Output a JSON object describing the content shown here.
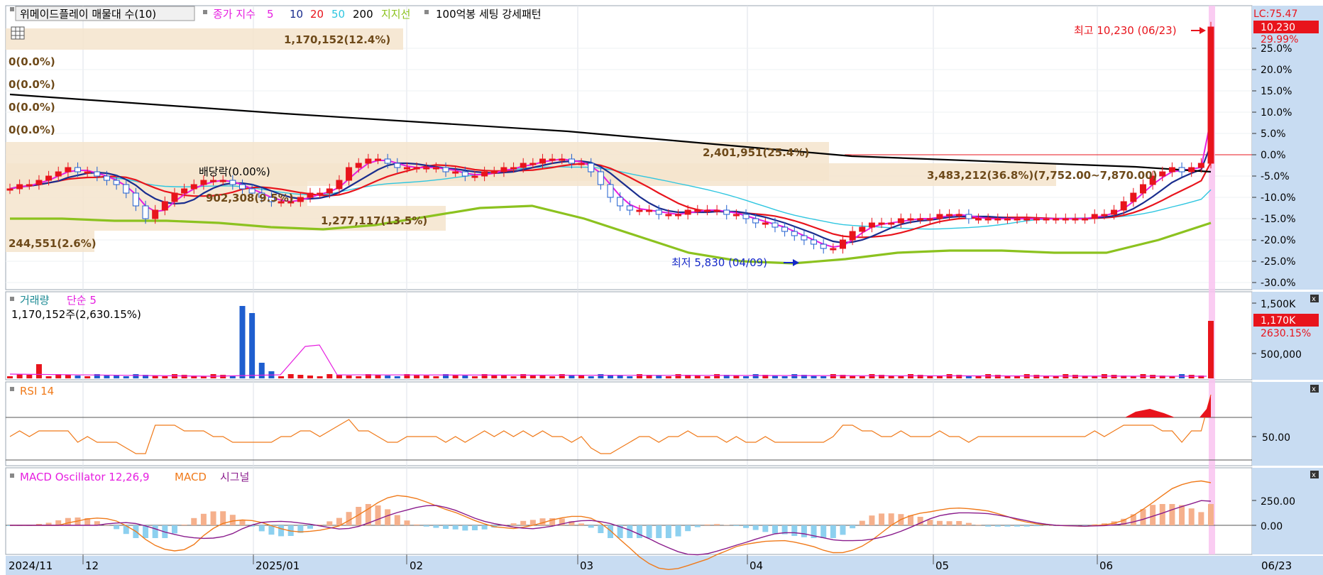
{
  "header": {
    "stock_label": "위메이드플레이 매물대 수(10)",
    "ma_prefix": "종가 지수",
    "ma_periods": [
      "5",
      "10",
      "20",
      "50",
      "200"
    ],
    "support_label": "지지선",
    "pattern_label": "100억봉 세팅 강세패턴"
  },
  "price_panel": {
    "lc_label": "LC:75.47",
    "current_price": "10,230",
    "current_pct": "29.99%",
    "high_label": "최고 10,230 (06/23)",
    "low_label": "최저 5,830 (04/09)",
    "dividend_label": "배당락(0.00%)",
    "axis_ticks": [
      "25.0%",
      "20.0%",
      "15.0%",
      "10.0%",
      "5.0%",
      "0.0%",
      "-5.0%",
      "-10.0%",
      "-15.0%",
      "-20.0%",
      "-25.0%",
      "-30.0%"
    ],
    "volume_profile_labels": [
      "1,170,152(12.4%)",
      "0(0.0%)",
      "0(0.0%)",
      "0(0.0%)",
      "0(0.0%)",
      "2,401,951(25.4%)",
      "3,483,212(36.8%)(7,752.00~7,870.00)",
      "902,308(9.5%)",
      "1,277,117(13.5%)",
      "244,551(2.6%)"
    ]
  },
  "volume_panel": {
    "title": "거래량",
    "ma_label": "단순 5",
    "info": "1,170,152주(2,630.15%)",
    "axis_ticks": [
      "1,500K",
      "500,000"
    ],
    "current_value": "1,170K",
    "current_pct": "2630.15%"
  },
  "rsi_panel": {
    "title": "RSI 14",
    "axis_tick": "50.00"
  },
  "macd_panel": {
    "title": "MACD Oscillator 12,26,9",
    "macd_label": "MACD",
    "signal_label": "시그널",
    "axis_ticks": [
      "250.00",
      "0.00"
    ]
  },
  "x_axis": {
    "labels": [
      "2024/11",
      "12",
      "2025/01",
      "02",
      "03",
      "04",
      "05",
      "06"
    ],
    "current_date": "06/23"
  },
  "colors": {
    "up": "#e8141c",
    "down": "#1e5ecf",
    "ma5": "#e61fe0",
    "ma10": "#1a2d8e",
    "ma20": "#e8141c",
    "ma50": "#2fc6e0",
    "ma200": "#000000",
    "support": "#8cc21f",
    "profile": "#f5e4cc",
    "axis_bg": "#c8dcf2",
    "highlight": "#f9c3f0"
  },
  "chart_data": {
    "type": "candlestick",
    "title": "위메이드플레이 매물대 수(10)",
    "x_range": [
      "2024/11",
      "06/23"
    ],
    "y_axis": "percent change",
    "ylim": [
      -30,
      25
    ],
    "high": {
      "value": 10230,
      "date": "06/23"
    },
    "low": {
      "value": 5830,
      "date": "04/09"
    },
    "last_close": 10230,
    "last_change_pct": 29.99,
    "volume_last": 1170152,
    "series_close_pct": [
      -8,
      -7,
      -7,
      -6,
      -5,
      -4,
      -3,
      -4,
      -4,
      -5,
      -6,
      -7,
      -9,
      -12,
      -15,
      -13,
      -11,
      -9,
      -8,
      -7,
      -6,
      -6,
      -6,
      -7,
      -8,
      -9,
      -10,
      -11,
      -11,
      -11,
      -10,
      -9,
      -9,
      -8,
      -6,
      -3,
      -2,
      -1,
      -1,
      -2,
      -3,
      -3,
      -3,
      -3,
      -3,
      -4,
      -4,
      -5,
      -5,
      -4,
      -4,
      -3,
      -3,
      -2,
      -2,
      -1,
      -1,
      -1,
      -2,
      -2,
      -4,
      -7,
      -10,
      -12,
      -13,
      -13,
      -13,
      -14,
      -14,
      -14,
      -13,
      -13,
      -13,
      -13,
      -14,
      -14,
      -15,
      -16,
      -16,
      -17,
      -18,
      -19,
      -20,
      -21,
      -22,
      -22,
      -20,
      -18,
      -17,
      -16,
      -16,
      -16,
      -15,
      -15,
      -15,
      -15,
      -14,
      -14,
      -14,
      -15,
      -15,
      -15,
      -15,
      -15,
      -15,
      -15,
      -15,
      -15,
      -15,
      -15,
      -15,
      -15,
      -14,
      -14,
      -13,
      -11,
      -9,
      -7,
      -5,
      -4,
      -3,
      -4,
      -3,
      -2,
      30
    ],
    "support_line_pct": [
      -15,
      -15,
      -15.5,
      -15.5,
      -16,
      -17,
      -17.5,
      -16.5,
      -14.5,
      -12.5,
      -12,
      -15,
      -19,
      -23,
      -25,
      -25.5,
      -24.5,
      -23,
      -22.5,
      -22.5,
      -23,
      -23,
      -20,
      -16
    ]
  }
}
